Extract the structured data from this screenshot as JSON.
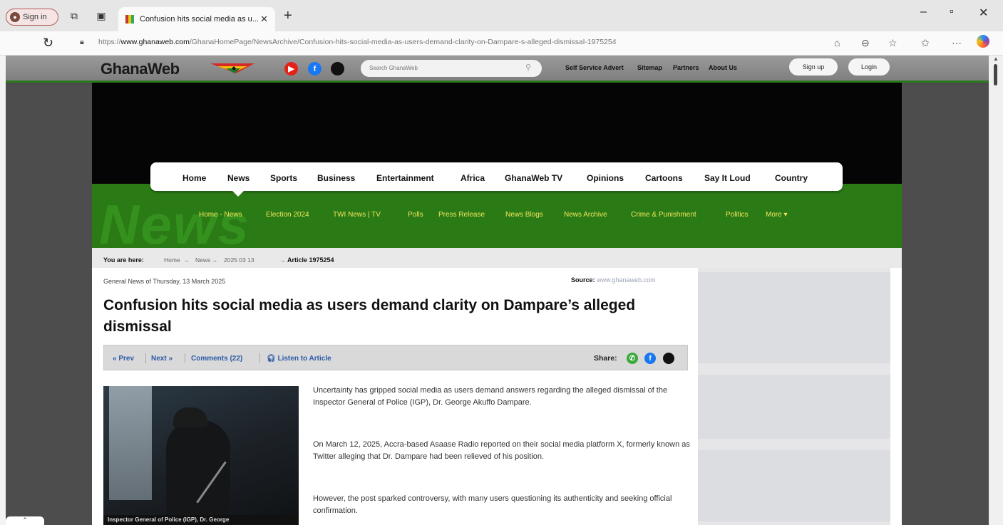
{
  "browser": {
    "signin_label": "Sign in",
    "tab_title": "Confusion hits social media as u...",
    "url_prefix": "https://",
    "url_domain": "www.ghanaweb.com",
    "url_path": "/GhanaHomePage/NewsArchive/Confusion-hits-social-media-as-users-demand-clarity-on-Dampare-s-alleged-dismissal-1975254"
  },
  "site": {
    "logo": "GhanaWeb",
    "search_placeholder": "Search GhanaWeb",
    "top_links": [
      "Self Service Advert",
      "Sitemap",
      "Partners",
      "About Us"
    ],
    "signup_label": "Sign up",
    "login_label": "Login",
    "brand_green": "#2a7a16",
    "nav_items": [
      "Home",
      "News",
      "Sports",
      "Business",
      "Entertainment",
      "Africa",
      "GhanaWeb TV",
      "Opinions",
      "Cartoons",
      "Say It Loud",
      "Country"
    ],
    "watermark": "News",
    "subnav_items": [
      "Home - News",
      "Election 2024",
      "TWI News | TV",
      "Polls",
      "Press Release",
      "News Blogs",
      "News Archive",
      "Crime & Punishment",
      "Politics",
      "More ▾"
    ]
  },
  "breadcrumb": {
    "label": "You are here:",
    "items": [
      "Home",
      "News",
      "2025 03 13",
      "Article 1975254"
    ],
    "separator": "→"
  },
  "article": {
    "meta": "General News of Thursday, 13 March 2025",
    "source_label": "Source:",
    "source_value": "www.ghanaweb.com",
    "headline": "Confusion hits social media as users demand clarity on Dampare’s alleged dismissal",
    "toolbar": {
      "prev": "« Prev",
      "next": "Next »",
      "comments": "Comments (22)",
      "listen": "Listen to Article",
      "share": "Share:"
    },
    "photo_caption": "Inspector General of Police (IGP), Dr. George",
    "paragraphs": [
      "Uncertainty has gripped social media as users demand answers regarding the alleged dismissal of the Inspector General of Police (IGP), Dr. George Akuffo Dampare.",
      "On March 12, 2025, Accra-based Asaase Radio reported on their social media platform X, formerly known as Twitter alleging that Dr. Dampare had been relieved of his position.",
      "However, the post sparked controversy, with many users questioning its authenticity and seeking official confirmation."
    ]
  }
}
